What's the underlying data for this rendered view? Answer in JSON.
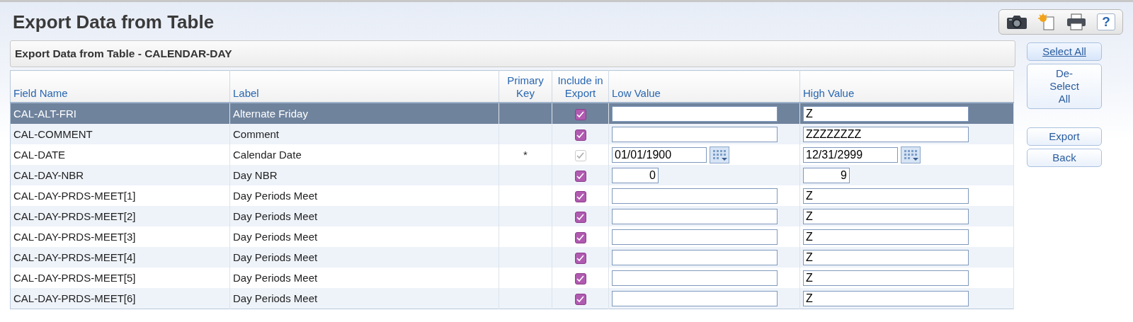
{
  "page": {
    "title": "Export Data from Table",
    "toolbar": {
      "help": "?"
    }
  },
  "panel": {
    "title": "Export Data from Table - CALENDAR-DAY"
  },
  "table": {
    "columns": [
      "Field Name",
      "Label",
      "Primary Key",
      "Include in Export",
      "Low Value",
      "High Value"
    ],
    "rows": [
      {
        "field": "CAL-ALT-FRI",
        "label": "Alternate Friday",
        "selected": true,
        "include": {
          "checked": true,
          "disabled": false
        },
        "kind": "text",
        "high": "Z"
      },
      {
        "field": "CAL-COMMENT",
        "label": "Comment",
        "selected": false,
        "include": {
          "checked": true,
          "disabled": false
        },
        "kind": "text",
        "high": "ZZZZZZZZ"
      },
      {
        "field": "CAL-DATE",
        "label": "Calendar Date",
        "primary": "*",
        "selected": false,
        "include": {
          "checked": true,
          "disabled": true
        },
        "kind": "date",
        "low": "01/01/1900",
        "high": "12/31/2999"
      },
      {
        "field": "CAL-DAY-NBR",
        "label": "Day NBR",
        "selected": false,
        "include": {
          "checked": true,
          "disabled": false
        },
        "kind": "number",
        "low": "0",
        "high": "9"
      },
      {
        "field": "CAL-DAY-PRDS-MEET[1]",
        "label": "Day Periods Meet",
        "selected": false,
        "include": {
          "checked": true,
          "disabled": false
        },
        "kind": "text",
        "high": "Z"
      },
      {
        "field": "CAL-DAY-PRDS-MEET[2]",
        "label": "Day Periods Meet",
        "selected": false,
        "include": {
          "checked": true,
          "disabled": false
        },
        "kind": "text",
        "high": "Z"
      },
      {
        "field": "CAL-DAY-PRDS-MEET[3]",
        "label": "Day Periods Meet",
        "selected": false,
        "include": {
          "checked": true,
          "disabled": false
        },
        "kind": "text",
        "high": "Z"
      },
      {
        "field": "CAL-DAY-PRDS-MEET[4]",
        "label": "Day Periods Meet",
        "selected": false,
        "include": {
          "checked": true,
          "disabled": false
        },
        "kind": "text",
        "high": "Z"
      },
      {
        "field": "CAL-DAY-PRDS-MEET[5]",
        "label": "Day Periods Meet",
        "selected": false,
        "include": {
          "checked": true,
          "disabled": false
        },
        "kind": "text",
        "high": "Z"
      },
      {
        "field": "CAL-DAY-PRDS-MEET[6]",
        "label": "Day Periods Meet",
        "selected": false,
        "include": {
          "checked": true,
          "disabled": false
        },
        "kind": "text",
        "high": "Z"
      }
    ]
  },
  "actions": [
    {
      "label": "Select All",
      "kind": "link"
    },
    {
      "label": "De-Select All",
      "kind": "button"
    },
    {
      "label": "Export",
      "kind": "button",
      "gap": true
    },
    {
      "label": "Back",
      "kind": "button"
    }
  ]
}
